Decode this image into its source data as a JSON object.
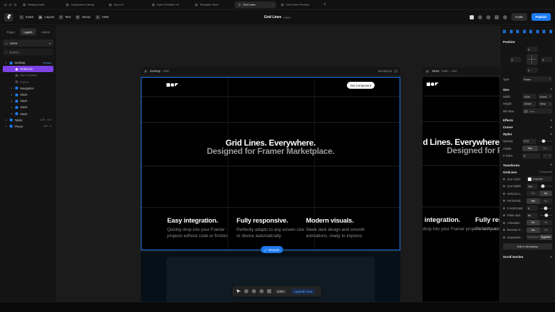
{
  "tabs": [
    {
      "label": "Helping Hand",
      "active": false
    },
    {
      "label": "Component Library",
      "active": false
    },
    {
      "label": "Aero v3",
      "active": false
    },
    {
      "label": "Kyle's Portfolio v3",
      "active": false
    },
    {
      "label": "Template Store",
      "active": false
    },
    {
      "label": "Grid Lines",
      "active": true
    },
    {
      "label": "Grid Lines Preview",
      "active": false
    }
  ],
  "toolbar": {
    "insert": "Insert",
    "layout": "Layout",
    "text": "Text",
    "vector": "Vector",
    "cms": "CMS",
    "project_name": "Grid Lines",
    "project_size": "FREE",
    "invite": "Invite",
    "publish": "Publish"
  },
  "left_panel": {
    "tabs": [
      "Pages",
      "Layers",
      "Assets"
    ],
    "active_tab": "Layers",
    "page": "Home",
    "search_placeholder": "Search...",
    "layers": [
      {
        "name": "Desktop",
        "meta": "Primary",
        "indent": 0,
        "kind": "frame"
      },
      {
        "name": "GridLines",
        "meta": "",
        "indent": 1,
        "kind": "component",
        "selected": true
      },
      {
        "name": "Blur Gradient",
        "meta": "",
        "indent": 1,
        "kind": "dim"
      },
      {
        "name": "Frame",
        "meta": "",
        "indent": 1,
        "kind": "dim"
      },
      {
        "name": "Navigation",
        "meta": "",
        "indent": 1,
        "kind": "frame"
      },
      {
        "name": "Stack",
        "meta": "",
        "indent": 1,
        "kind": "frame"
      },
      {
        "name": "Stack",
        "meta": "",
        "indent": 1,
        "kind": "frame"
      },
      {
        "name": "Stack",
        "meta": "",
        "indent": 1,
        "kind": "frame"
      },
      {
        "name": "Stack",
        "meta": "",
        "indent": 1,
        "kind": "frame"
      },
      {
        "name": "Tablet",
        "meta": "1199 - 810",
        "indent": 0,
        "kind": "frame"
      },
      {
        "name": "Phone",
        "meta": "809 - 0",
        "indent": 0,
        "kind": "frame"
      }
    ]
  },
  "canvas": {
    "desktop_label": "Desktop",
    "desktop_size": "1200",
    "breakpoint_label": "Breakpoint",
    "tablet_label": "Tablet",
    "tablet_size": "1199 — 810",
    "get_component": "Get Component",
    "hero_line1": "Grid Lines. Everywhere.",
    "hero_line2": "Designed for Framer Marketplace.",
    "features": [
      {
        "title": "Easy integration.",
        "text": "Quickly drop into your Framer projects without code or friction."
      },
      {
        "title": "Fully responsive.",
        "text": "Perfectly adapts to any screen size or device automatically."
      },
      {
        "title": "Modern visuals.",
        "text": "Sleek dark design and smooth animations, ready to impress."
      }
    ],
    "tablet_features": [
      {
        "title": "Easy integration.",
        "text": "Quickly drop into your Framer projects without code or friction."
      },
      {
        "title": "Fully res",
        "text": "Perfectly ad size or devic"
      }
    ],
    "viewport_button": "Viewport",
    "zoom": "100%",
    "upgrade": "Upgrade Now"
  },
  "right_panel": {
    "position_title": "Position",
    "pos_values": {
      "top": "0",
      "left": "0",
      "right": "0",
      "bottom": "0"
    },
    "type_label": "Type",
    "type_value": "Fixed",
    "size_title": "Size",
    "width_label": "Width",
    "width_value": "1200",
    "width_mode": "Fixed",
    "height_label": "Height",
    "height_value": "100vh",
    "height_mode": "View",
    "minmax_label": "Min Max",
    "minmax_value": "Add...",
    "effects_title": "Effects",
    "cursor_title": "Cursor",
    "styles_title": "Styles",
    "opacity_label": "Opacity",
    "opacity_value": "0.27",
    "opacity_level": 0.27,
    "visible_label": "Visible",
    "visible_yes": "Yes",
    "visible_no": "No",
    "zindex_label": "Z Index",
    "zindex_value": "0",
    "transforms_title": "Transforms",
    "component_name": "GridLines",
    "component_kind": "Component",
    "props": {
      "line_color_label": "Line Color",
      "line_color_value": "FFFFFF",
      "line_width_label": "Line Width",
      "line_width_value": "1px",
      "vertical_label": "Vertical Li...",
      "vertical_yes": "Yes",
      "vertical_no": "No",
      "horizontal_label": "Horizontal...",
      "horizontal_yes": "Yes",
      "horizontal_no": "No",
      "hhorizontal_label": "# Horizontal",
      "hhorizontal_value": "5",
      "pulse_label": "Pulse Spe...",
      "pulse_value": "5s",
      "animation_label": "Animation",
      "animation_on": "On",
      "animation_off": "Off",
      "reverse_label": "Reverse F...",
      "reverse_on": "On",
      "reverse_off": "Off",
      "sequence_label": "Sequentia...",
      "sequence_a": "Sequence",
      "sequence_b": "Together"
    },
    "edit_button": "Edit in Workshop",
    "scroll_title": "Scroll Section"
  }
}
